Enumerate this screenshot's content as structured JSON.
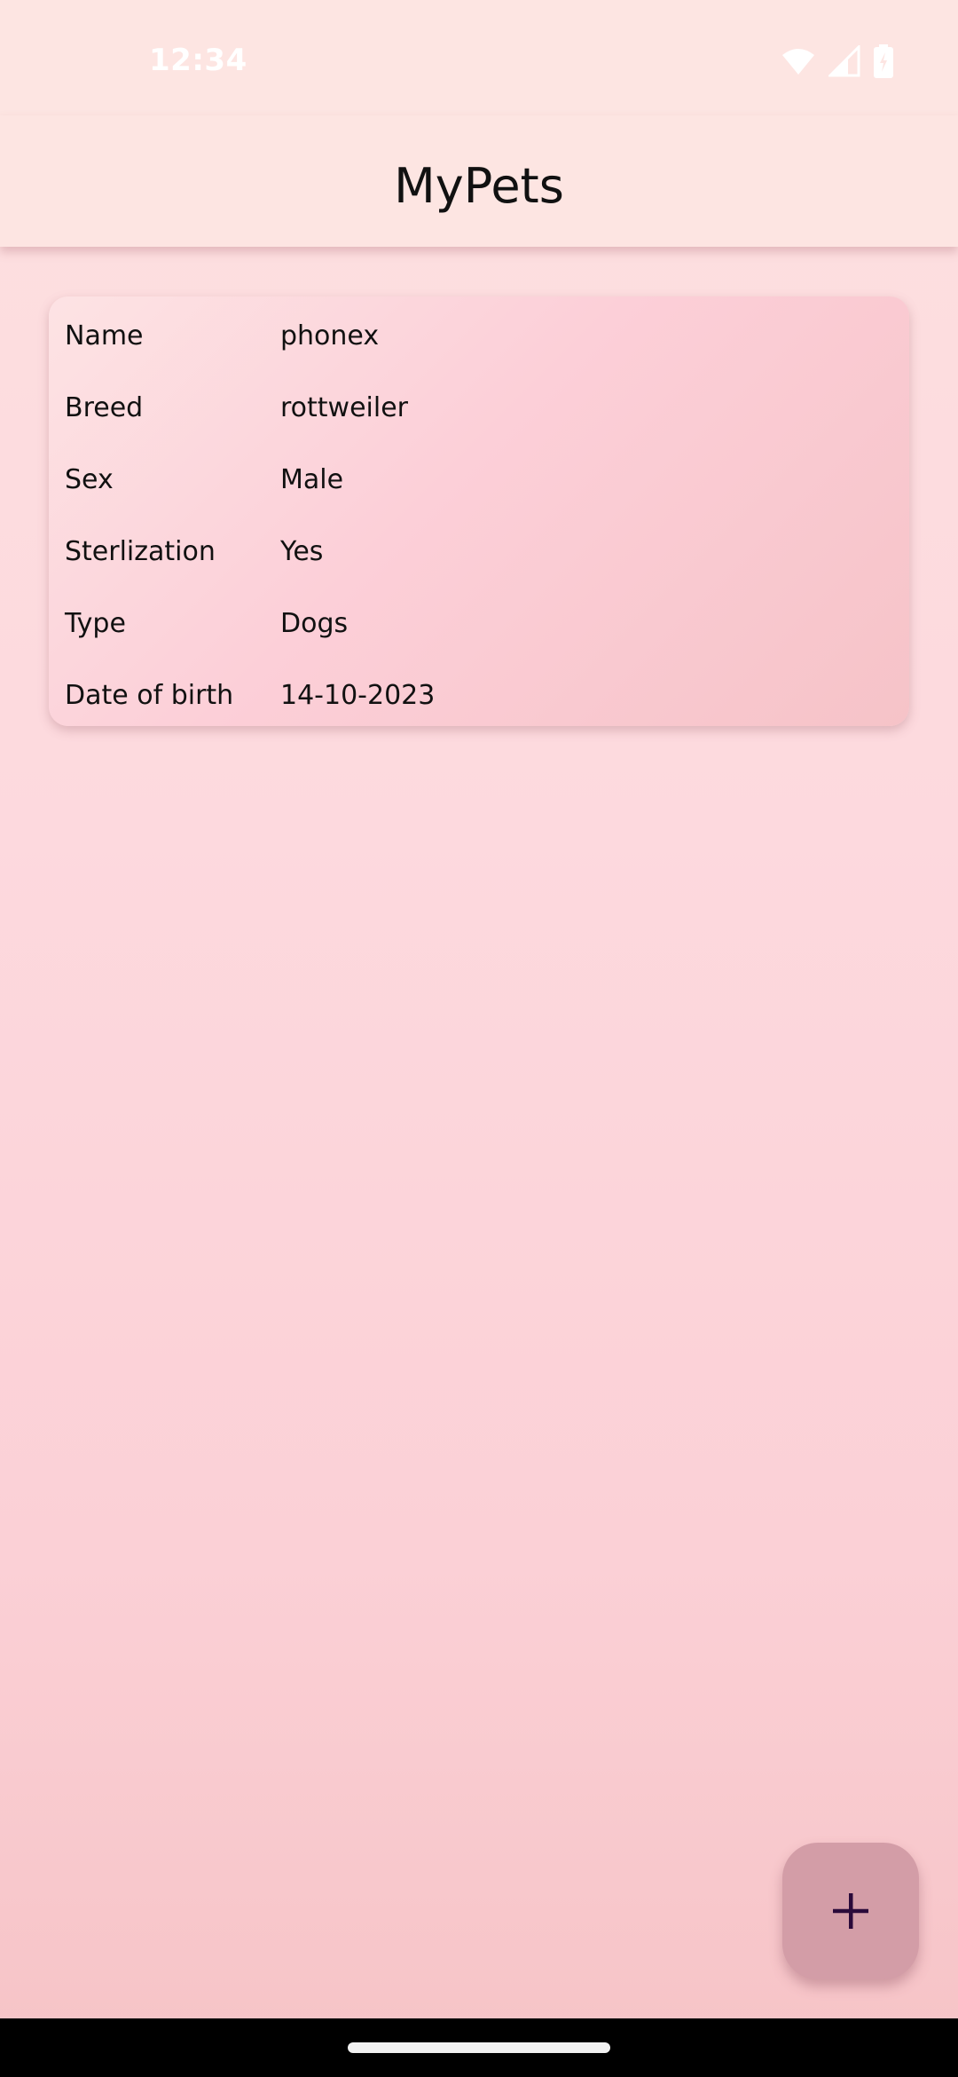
{
  "status_bar": {
    "time": "12:34",
    "icons": [
      "wifi-icon",
      "signal-icon",
      "battery-charging-icon"
    ]
  },
  "app_bar": {
    "title": "MyPets"
  },
  "pet_card": {
    "rows": [
      {
        "label": "Name",
        "value": "phonex"
      },
      {
        "label": "Breed",
        "value": "rottweiler"
      },
      {
        "label": "Sex",
        "value": "Male"
      },
      {
        "label": "Sterlization",
        "value": "Yes"
      },
      {
        "label": "Type",
        "value": "Dogs"
      },
      {
        "label": "Date of birth",
        "value": "14-10-2023"
      }
    ]
  },
  "fab": {
    "icon": "plus-icon"
  },
  "colors": {
    "app_bar_bg": "#fde5e2",
    "fab_bg": "#d39da7",
    "fab_icon": "#2a0a3a"
  }
}
